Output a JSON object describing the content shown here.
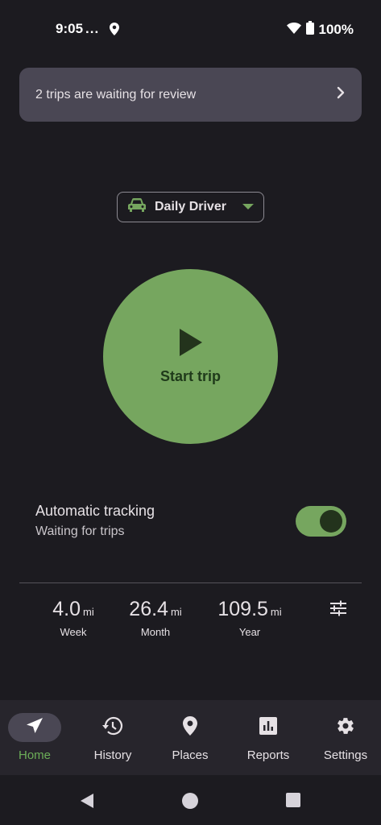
{
  "status": {
    "time": "9:05",
    "dots": "...",
    "battery": "100%"
  },
  "banner": {
    "text": "2 trips are waiting for review"
  },
  "vehicle": {
    "label": "Daily Driver"
  },
  "start_trip": {
    "label": "Start trip"
  },
  "auto_tracking": {
    "title": "Automatic tracking",
    "subtitle": "Waiting for trips",
    "enabled": true
  },
  "stats": [
    {
      "value": "4.0",
      "unit": "mi",
      "label": "Week"
    },
    {
      "value": "26.4",
      "unit": "mi",
      "label": "Month"
    },
    {
      "value": "109.5",
      "unit": "mi",
      "label": "Year"
    }
  ],
  "nav": [
    {
      "label": "Home",
      "icon": "navigation-arrow-icon",
      "active": true
    },
    {
      "label": "History",
      "icon": "history-icon",
      "active": false
    },
    {
      "label": "Places",
      "icon": "place-pin-icon",
      "active": false
    },
    {
      "label": "Reports",
      "icon": "bar-chart-icon",
      "active": false
    },
    {
      "label": "Settings",
      "icon": "gear-icon",
      "active": false
    }
  ],
  "colors": {
    "accent": "#76a65f",
    "active_nav": "#6cae58",
    "background": "#1c1b20",
    "banner": "#4a4754"
  }
}
